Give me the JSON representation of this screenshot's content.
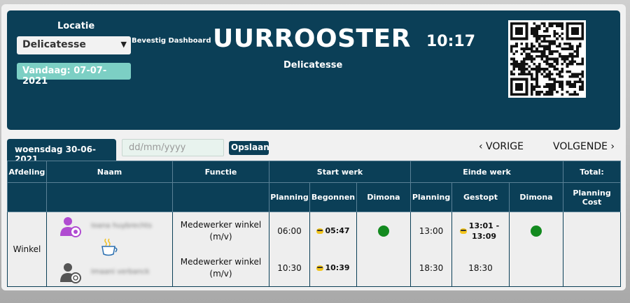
{
  "header": {
    "location_label": "Locatie",
    "location_value": "Delicatesse",
    "confirm_label": "Bevestig Dashboard",
    "today_label": "Vandaag: 07-07-2021",
    "title": "UURROOSTER",
    "subtitle": "Delicatesse",
    "clock": "10:17",
    "qr_icon": "qr-code-icon"
  },
  "toolbar": {
    "date_tab": "woensdag 30-06-2021",
    "date_placeholder": "dd/mm/yyyy",
    "save_label": "Opslaan",
    "prev_label": "‹ VORIGE",
    "next_label": "VOLGENDE ›"
  },
  "table": {
    "headers": {
      "afdeling": "Afdeling",
      "naam": "Naam",
      "functie": "Functie",
      "start_werk": "Start werk",
      "einde_werk": "Einde werk",
      "total": "Total:",
      "start_planning": "Planning",
      "start_begonnen": "Begonnen",
      "start_dimona": "Dimona",
      "end_planning": "Planning",
      "end_gestopt": "Gestopt",
      "end_dimona": "Dimona",
      "planning_cost": "Planning Cost"
    },
    "department": "Winkel",
    "rows": [
      {
        "name": "Ioana huybrechts",
        "function": "Medewerker winkel (m/v)",
        "start_planning": "06:00",
        "started": "05:47",
        "start_dimona": "green",
        "end_planning": "13:00",
        "stopped": "13:01 - 13:09",
        "end_dimona": "green"
      },
      {
        "name": "Imaani verbanck",
        "function": "Medewerker winkel (m/v)",
        "start_planning": "10:30",
        "started": "10:39",
        "end_planning": "18:30",
        "stopped": "18:30"
      }
    ]
  },
  "colors": {
    "header_bg": "#0b3f57",
    "today_bg": "#7ccfc4",
    "dimona_ok": "#138a1f",
    "avatar_active": "#b04bd1",
    "avatar_inactive": "#555555"
  }
}
